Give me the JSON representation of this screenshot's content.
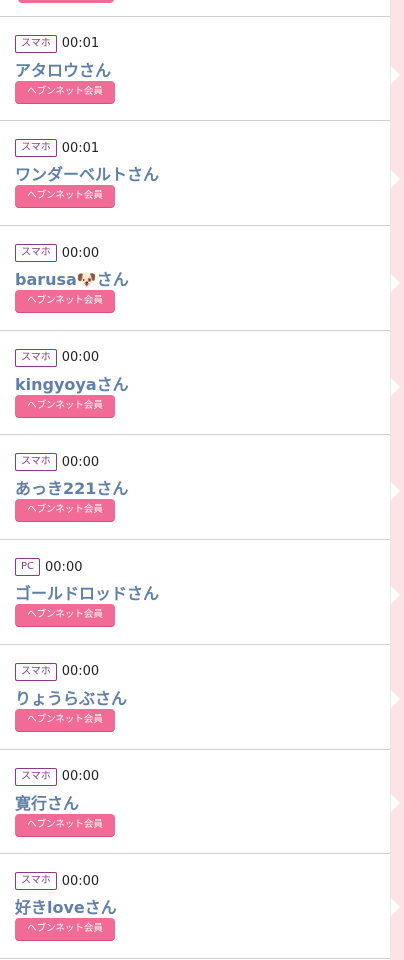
{
  "visitors": [
    {
      "device": "スマホ",
      "time": "00:01",
      "name": "アタロウさん",
      "badge": "ヘブンネット会員"
    },
    {
      "device": "スマホ",
      "time": "00:01",
      "name": "ワンダーベルトさん",
      "badge": "ヘブンネット会員"
    },
    {
      "device": "スマホ",
      "time": "00:00",
      "name": "barusa🐶さん",
      "badge": "ヘブンネット会員"
    },
    {
      "device": "スマホ",
      "time": "00:00",
      "name": "kingyoyaさん",
      "badge": "ヘブンネット会員"
    },
    {
      "device": "スマホ",
      "time": "00:00",
      "name": "あっき221さん",
      "badge": "ヘブンネット会員"
    },
    {
      "device": "PC",
      "time": "00:00",
      "name": "ゴールドロッドさん",
      "badge": "ヘブンネット会員"
    },
    {
      "device": "スマホ",
      "time": "00:00",
      "name": "りょうらぶさん",
      "badge": "ヘブンネット会員"
    },
    {
      "device": "スマホ",
      "time": "00:00",
      "name": "寛行さん",
      "badge": "ヘブンネット会員"
    },
    {
      "device": "スマホ",
      "time": "00:00",
      "name": "好きloveさん",
      "badge": "ヘブンネット会員"
    }
  ],
  "colors": {
    "name": "#5f7fa8",
    "badge_bg": "#f26b97",
    "device_border": "#8a3a8a",
    "sidebar_bg": "#fde3e5"
  }
}
